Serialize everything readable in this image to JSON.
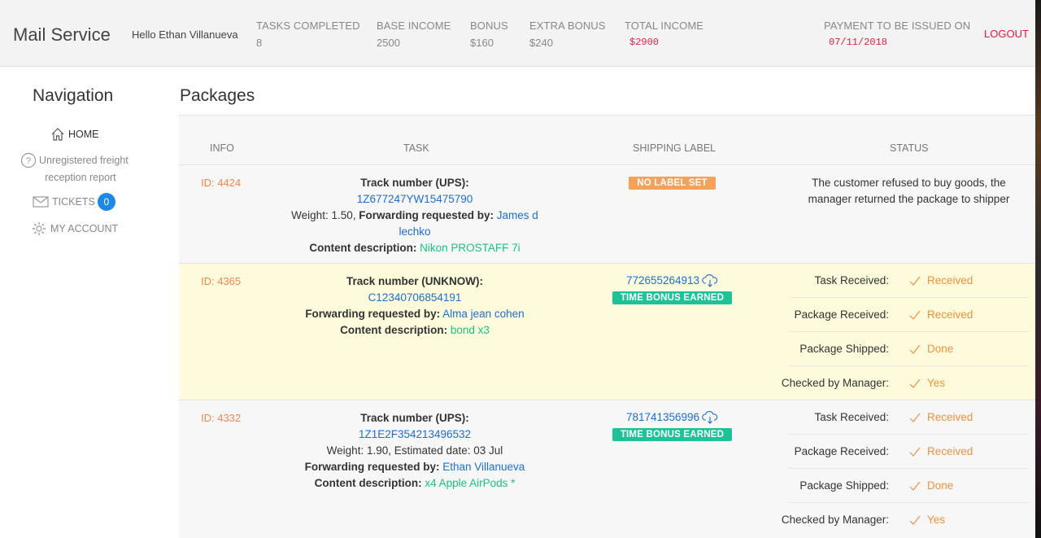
{
  "header": {
    "brand": "Mail Service",
    "greeting": "Hello Ethan Villanueva",
    "stats": [
      {
        "label": "TASKS COMPLETED",
        "value": "8"
      },
      {
        "label": "BASE INCOME",
        "value": "2500"
      },
      {
        "label": "BONUS",
        "value": "$160"
      },
      {
        "label": "EXTRA BONUS",
        "value": "$240"
      },
      {
        "label": "TOTAL INCOME",
        "value": "$2900"
      },
      {
        "label": "PAYMENT TO BE ISSUED ON",
        "value": "07/11/2018"
      }
    ],
    "logout": "LOGOUT",
    "accent_color": "#e0173e"
  },
  "sidebar": {
    "title": "Navigation",
    "items": [
      {
        "label": "HOME",
        "icon": "home-icon"
      },
      {
        "label": "Unregistered freight reception report",
        "line1": "Unregistered freight",
        "line2": "reception report",
        "icon": "question-circle-icon"
      },
      {
        "label": "TICKETS",
        "icon": "envelope-icon",
        "badge": "0"
      },
      {
        "label": "MY ACCOUNT",
        "icon": "gear-icon"
      }
    ]
  },
  "main": {
    "title": "Packages",
    "columns": [
      "INFO",
      "TASK",
      "SHIPPING LABEL",
      "STATUS"
    ],
    "packages": [
      {
        "id": "ID: 4424",
        "track_label": "Track number (UPS):",
        "track_number": "1Z677247YW15475790",
        "weight_text": "Weight: 1.50,",
        "forward_label": "Forwarding requested by:",
        "forward_by_1": "James d",
        "forward_by_2": "lechko",
        "content_label": "Content description:",
        "content": "Nikon PROSTAFF 7i",
        "shipping_tag": "NO LABEL SET",
        "status_line1": "The customer refused to buy goods, the",
        "status_line2": "manager returned the package to shipper"
      },
      {
        "id": "ID: 4365",
        "track_label": "Track number (UNKNOW):",
        "track_number": "C12340706854191",
        "forward_label": "Forwarding requested by:",
        "forward_by": "Alma jean cohen",
        "content_label": "Content description:",
        "content": "bond x3",
        "shipping_number": "772655264913",
        "shipping_tag": "TIME BONUS EARNED",
        "statuses": [
          {
            "key": "Task Received:",
            "value": "Received"
          },
          {
            "key": "Package Received:",
            "value": "Received"
          },
          {
            "key": "Package Shipped:",
            "value": "Done"
          },
          {
            "key": "Checked by Manager:",
            "value": "Yes"
          }
        ]
      },
      {
        "id": "ID: 4332",
        "track_label": "Track number (UPS):",
        "track_number": "1Z1E2F354213496532",
        "weight_text": "Weight: 1.90, Estimated date: 03 Jul",
        "forward_label": "Forwarding requested by:",
        "forward_by": "Ethan Villanueva",
        "content_label": "Content description:",
        "content": "x4 Apple AirPods *",
        "shipping_number": "781741356996",
        "shipping_tag": "TIME BONUS EARNED",
        "statuses": [
          {
            "key": "Task Received:",
            "value": "Received"
          },
          {
            "key": "Package Received:",
            "value": "Received"
          },
          {
            "key": "Package Shipped:",
            "value": "Done"
          },
          {
            "key": "Checked by Manager:",
            "value": "Yes"
          }
        ]
      }
    ]
  }
}
